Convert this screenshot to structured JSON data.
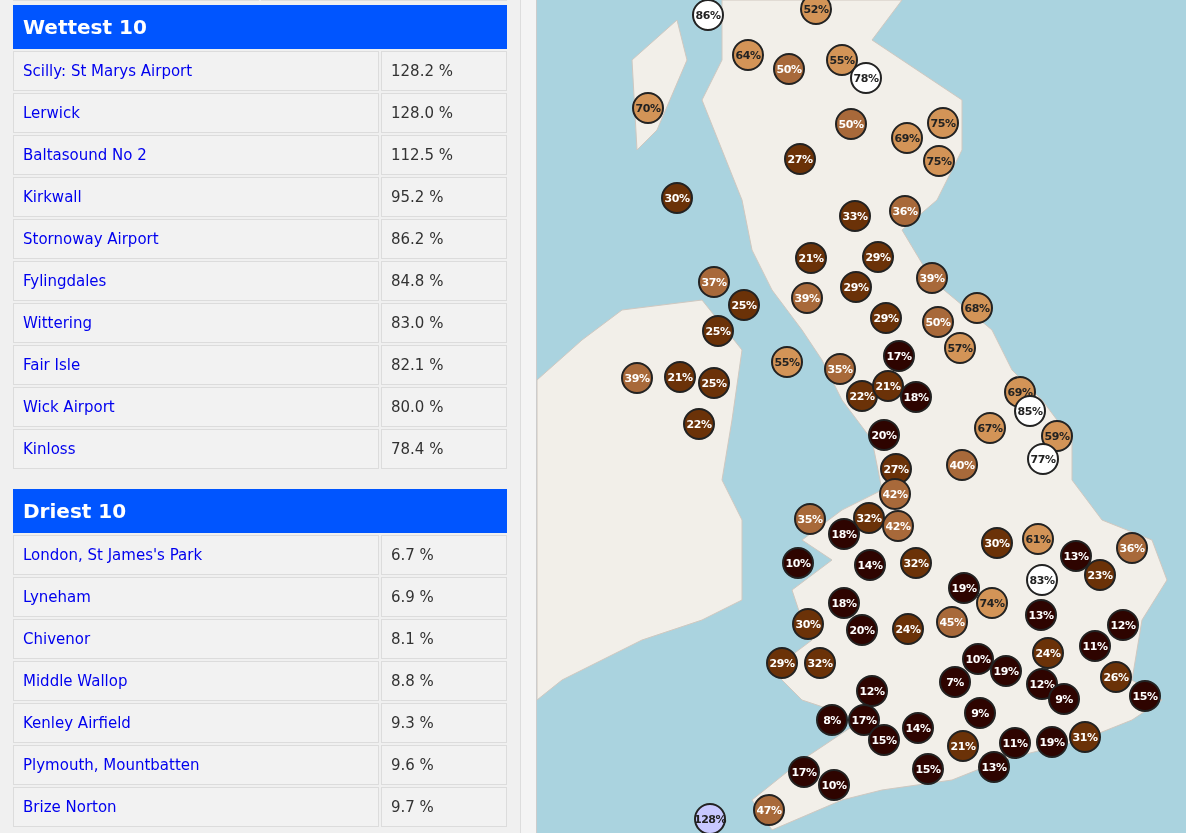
{
  "wettest": {
    "title": "Wettest 10",
    "rows": [
      {
        "name": "Scilly: St Marys Airport",
        "value": "128.2 %"
      },
      {
        "name": "Lerwick",
        "value": "128.0 %"
      },
      {
        "name": "Baltasound No 2",
        "value": "112.5 %"
      },
      {
        "name": "Kirkwall",
        "value": "95.2 %"
      },
      {
        "name": "Stornoway Airport",
        "value": "86.2 %"
      },
      {
        "name": "Fylingdales",
        "value": "84.8 %"
      },
      {
        "name": "Wittering",
        "value": "83.0 %"
      },
      {
        "name": "Fair Isle",
        "value": "82.1 %"
      },
      {
        "name": "Wick Airport",
        "value": "80.0 %"
      },
      {
        "name": "Kinloss",
        "value": "78.4 %"
      }
    ]
  },
  "driest": {
    "title": "Driest 10",
    "rows": [
      {
        "name": "London, St James's Park",
        "value": "6.7 %"
      },
      {
        "name": "Lyneham",
        "value": "6.9 %"
      },
      {
        "name": "Chivenor",
        "value": "8.1 %"
      },
      {
        "name": "Middle Wallop",
        "value": "8.8 %"
      },
      {
        "name": "Kenley Airfield",
        "value": "9.3 %"
      },
      {
        "name": "Plymouth, Mountbatten",
        "value": "9.6 %"
      },
      {
        "name": "Brize Norton",
        "value": "9.7 %"
      }
    ]
  },
  "map": {
    "markers": [
      {
        "label": "86%",
        "color": "#ffffff"
      },
      {
        "label": "52%",
        "color": "#d39457"
      },
      {
        "label": "64%",
        "color": "#d39457"
      },
      {
        "label": "50%",
        "color": "#a8693a"
      },
      {
        "label": "55%",
        "color": "#d39457"
      },
      {
        "label": "78%",
        "color": "#ffffff"
      },
      {
        "label": "70%",
        "color": "#d39457"
      },
      {
        "label": "50%",
        "color": "#a8693a"
      },
      {
        "label": "69%",
        "color": "#d39457"
      },
      {
        "label": "75%",
        "color": "#d39457"
      },
      {
        "label": "75%",
        "color": "#d39457"
      },
      {
        "label": "27%",
        "color": "#6b3208"
      },
      {
        "label": "30%",
        "color": "#6b3208"
      },
      {
        "label": "33%",
        "color": "#6b3208"
      },
      {
        "label": "36%",
        "color": "#a8693a"
      },
      {
        "label": "21%",
        "color": "#6b3208"
      },
      {
        "label": "29%",
        "color": "#6b3208"
      },
      {
        "label": "37%",
        "color": "#a8693a"
      },
      {
        "label": "39%",
        "color": "#a8693a"
      },
      {
        "label": "29%",
        "color": "#6b3208"
      },
      {
        "label": "25%",
        "color": "#6b3208"
      },
      {
        "label": "39%",
        "color": "#a8693a"
      },
      {
        "label": "68%",
        "color": "#d39457"
      },
      {
        "label": "29%",
        "color": "#6b3208"
      },
      {
        "label": "50%",
        "color": "#a8693a"
      },
      {
        "label": "57%",
        "color": "#d39457"
      },
      {
        "label": "17%",
        "color": "#2e0400"
      },
      {
        "label": "25%",
        "color": "#6b3208"
      },
      {
        "label": "21%",
        "color": "#6b3208"
      },
      {
        "label": "25%",
        "color": "#6b3208"
      },
      {
        "label": "39%",
        "color": "#a8693a"
      },
      {
        "label": "55%",
        "color": "#d39457"
      },
      {
        "label": "35%",
        "color": "#a8693a"
      },
      {
        "label": "22%",
        "color": "#6b3208"
      },
      {
        "label": "21%",
        "color": "#6b3208"
      },
      {
        "label": "18%",
        "color": "#2e0400"
      },
      {
        "label": "69%",
        "color": "#d39457"
      },
      {
        "label": "85%",
        "color": "#ffffff"
      },
      {
        "label": "67%",
        "color": "#d39457"
      },
      {
        "label": "22%",
        "color": "#6b3208"
      },
      {
        "label": "20%",
        "color": "#2e0400"
      },
      {
        "label": "27%",
        "color": "#6b3208"
      },
      {
        "label": "40%",
        "color": "#a8693a"
      },
      {
        "label": "59%",
        "color": "#d39457"
      },
      {
        "label": "77%",
        "color": "#ffffff"
      },
      {
        "label": "42%",
        "color": "#a8693a"
      },
      {
        "label": "35%",
        "color": "#a8693a"
      },
      {
        "label": "32%",
        "color": "#6b3208"
      },
      {
        "label": "42%",
        "color": "#a8693a"
      },
      {
        "label": "18%",
        "color": "#2e0400"
      },
      {
        "label": "10%",
        "color": "#2e0400"
      },
      {
        "label": "14%",
        "color": "#2e0400"
      },
      {
        "label": "32%",
        "color": "#6b3208"
      },
      {
        "label": "30%",
        "color": "#6b3208"
      },
      {
        "label": "61%",
        "color": "#d39457"
      },
      {
        "label": "13%",
        "color": "#2e0400"
      },
      {
        "label": "36%",
        "color": "#a8693a"
      },
      {
        "label": "23%",
        "color": "#6b3208"
      },
      {
        "label": "83%",
        "color": "#ffffff"
      },
      {
        "label": "19%",
        "color": "#2e0400"
      },
      {
        "label": "74%",
        "color": "#d39457"
      },
      {
        "label": "13%",
        "color": "#2e0400"
      },
      {
        "label": "18%",
        "color": "#2e0400"
      },
      {
        "label": "30%",
        "color": "#6b3208"
      },
      {
        "label": "20%",
        "color": "#2e0400"
      },
      {
        "label": "24%",
        "color": "#6b3208"
      },
      {
        "label": "45%",
        "color": "#a8693a"
      },
      {
        "label": "12%",
        "color": "#2e0400"
      },
      {
        "label": "11%",
        "color": "#2e0400"
      },
      {
        "label": "24%",
        "color": "#6b3208"
      },
      {
        "label": "10%",
        "color": "#2e0400"
      },
      {
        "label": "19%",
        "color": "#2e0400"
      },
      {
        "label": "26%",
        "color": "#6b3208"
      },
      {
        "label": "12%",
        "color": "#2e0400"
      },
      {
        "label": "9%",
        "color": "#2e0400"
      },
      {
        "label": "7%",
        "color": "#2e0400"
      },
      {
        "label": "12%",
        "color": "#2e0400"
      },
      {
        "label": "29%",
        "color": "#6b3208"
      },
      {
        "label": "32%",
        "color": "#6b3208"
      },
      {
        "label": "15%",
        "color": "#2e0400"
      },
      {
        "label": "9%",
        "color": "#2e0400"
      },
      {
        "label": "8%",
        "color": "#2e0400"
      },
      {
        "label": "17%",
        "color": "#2e0400"
      },
      {
        "label": "14%",
        "color": "#2e0400"
      },
      {
        "label": "15%",
        "color": "#2e0400"
      },
      {
        "label": "21%",
        "color": "#6b3208"
      },
      {
        "label": "11%",
        "color": "#2e0400"
      },
      {
        "label": "19%",
        "color": "#2e0400"
      },
      {
        "label": "31%",
        "color": "#6b3208"
      },
      {
        "label": "15%",
        "color": "#2e0400"
      },
      {
        "label": "13%",
        "color": "#2e0400"
      },
      {
        "label": "17%",
        "color": "#2e0400"
      },
      {
        "label": "10%",
        "color": "#2e0400"
      },
      {
        "label": "47%",
        "color": "#a8693a"
      },
      {
        "label": "128%",
        "color": "#c8c8ff"
      }
    ]
  }
}
